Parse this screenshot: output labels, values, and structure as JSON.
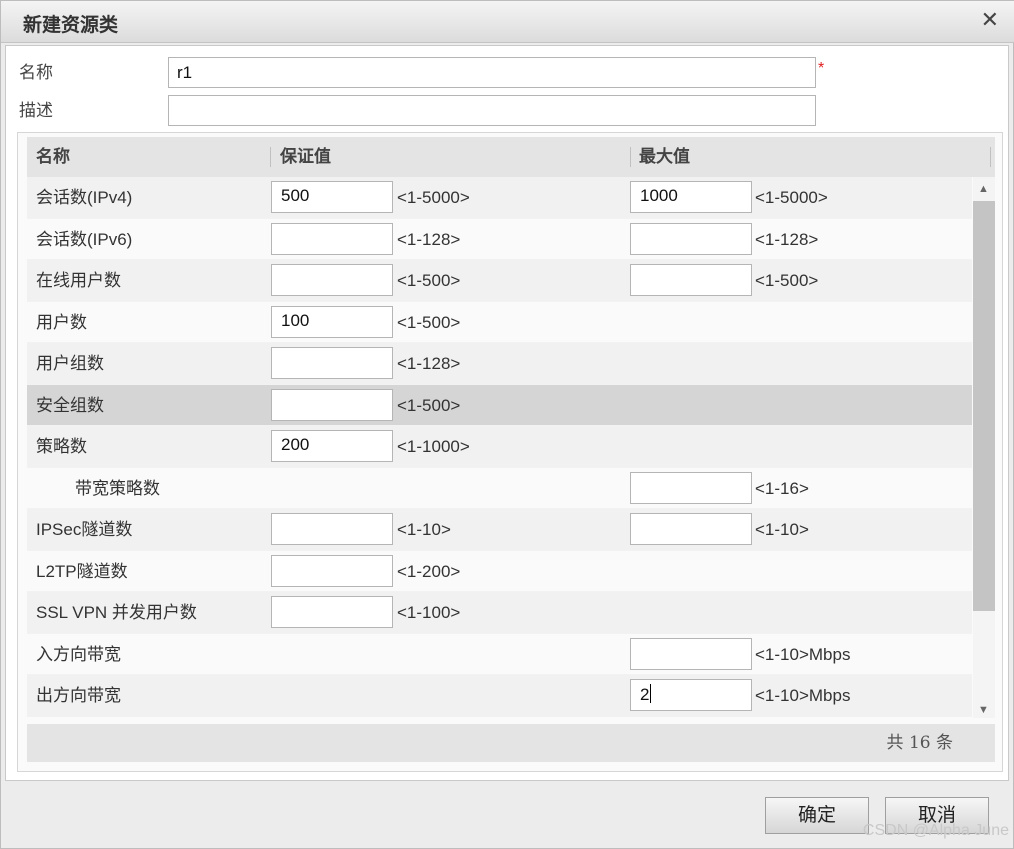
{
  "dialog": {
    "title": "新建资源类",
    "close_glyph": "✕"
  },
  "form": {
    "name_label": "名称",
    "name_value": "r1",
    "required_mark": "*",
    "desc_label": "描述",
    "desc_value": ""
  },
  "grid": {
    "headers": {
      "name": "名称",
      "guarantee": "保证值",
      "max": "最大值"
    },
    "rows": [
      {
        "name": "会话数(IPv4)",
        "g_value": "500",
        "g_range": "<1-5000>",
        "m_value": "1000",
        "m_range": "<1-5000>"
      },
      {
        "name": "会话数(IPv6)",
        "g_value": "",
        "g_range": "<1-128>",
        "m_value": "",
        "m_range": "<1-128>"
      },
      {
        "name": "在线用户数",
        "g_value": "",
        "g_range": "<1-500>",
        "m_value": "",
        "m_range": "<1-500>"
      },
      {
        "name": "用户数",
        "g_value": "100",
        "g_range": "<1-500>"
      },
      {
        "name": "用户组数",
        "g_value": "",
        "g_range": "<1-128>"
      },
      {
        "name": "安全组数",
        "g_value": "",
        "g_range": "<1-500>"
      },
      {
        "name": "策略数",
        "g_value": "200",
        "g_range": "<1-1000>"
      },
      {
        "name": "带宽策略数",
        "m_value": "",
        "m_range": "<1-16>"
      },
      {
        "name": "IPSec隧道数",
        "g_value": "",
        "g_range": "<1-10>",
        "m_value": "",
        "m_range": "<1-10>"
      },
      {
        "name": "L2TP隧道数",
        "g_value": "",
        "g_range": "<1-200>"
      },
      {
        "name": "SSL VPN 并发用户数",
        "g_value": "",
        "g_range": "<1-100>"
      },
      {
        "name": "入方向带宽",
        "m_value": "",
        "m_range": "<1-10>Mbps"
      },
      {
        "name": "出方向带宽",
        "m_value": "2",
        "m_range": "<1-10>Mbps"
      },
      {
        "name": "",
        "m_value": "",
        "m_range": ""
      }
    ],
    "selected_row": "安全组数",
    "footer_total": "共 16 条"
  },
  "buttons": {
    "ok": "确定",
    "cancel": "取消"
  },
  "watermark": "CSDN @Alpha June",
  "icons": {
    "close": "close-icon",
    "scroll_up": "scroll-up-icon",
    "scroll_down": "scroll-down-icon"
  }
}
